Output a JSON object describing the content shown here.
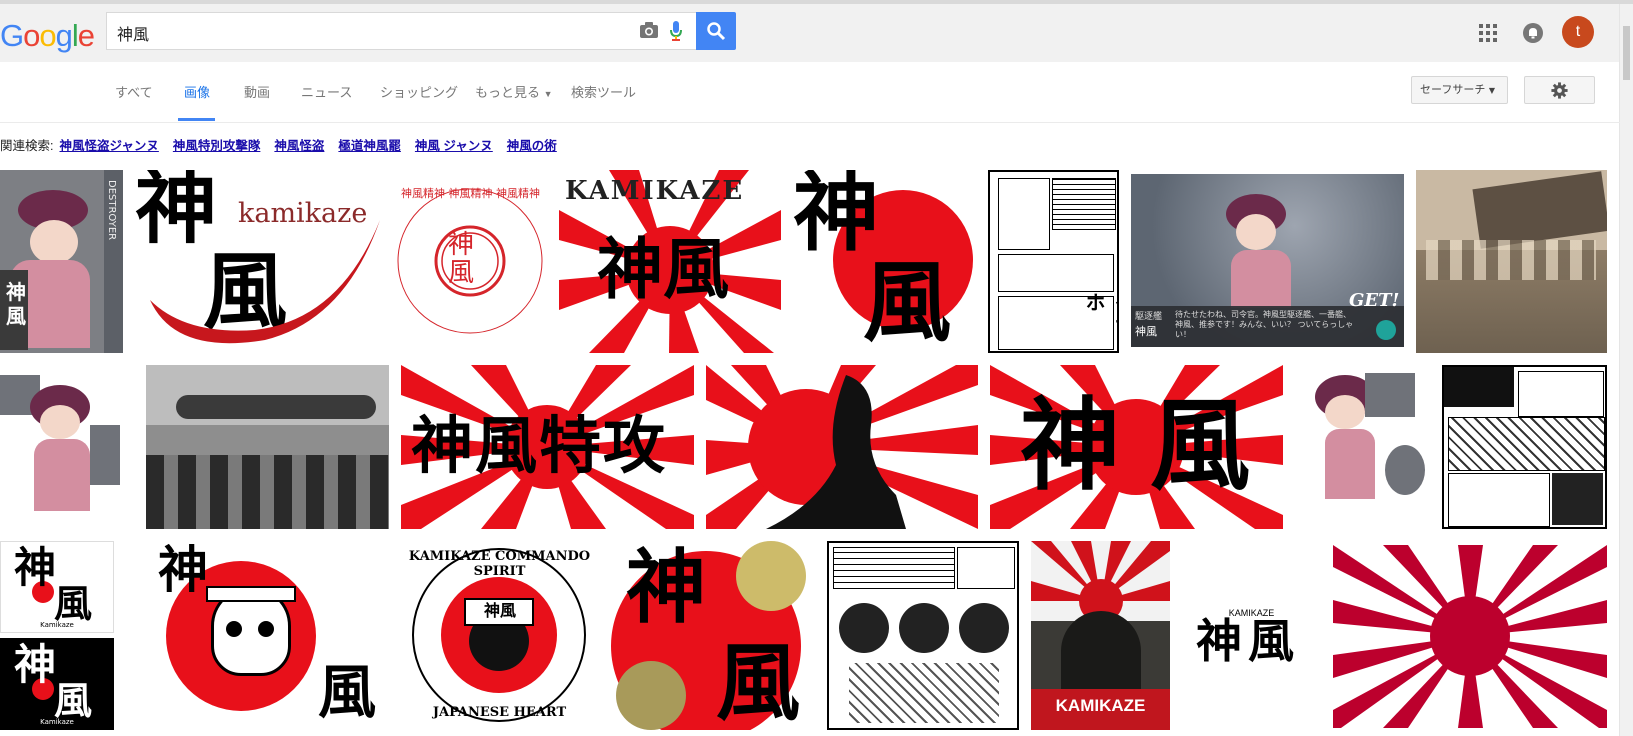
{
  "header": {
    "logo_letters": [
      "G",
      "o",
      "o",
      "g",
      "l",
      "e"
    ],
    "logo_colors": [
      "#4285f4",
      "#ea4335",
      "#fbbc05",
      "#4285f4",
      "#34a853",
      "#ea4335"
    ],
    "search_value": "神風",
    "avatar_letter": "t"
  },
  "nav": {
    "tabs": [
      "すべて",
      "画像",
      "動画",
      "ニュース",
      "ショッピング",
      "もっと見る",
      "検索ツール"
    ],
    "safesearch": "セーフサーチ"
  },
  "related": {
    "label": "関連検索:",
    "links": [
      "神風怪盗ジャンヌ",
      "神風特別攻撃隊",
      "神風怪盗",
      "極道神風罷",
      "神風 ジャンヌ",
      "神風の術"
    ]
  },
  "images": {
    "kamikaze_logo_text": "kamikaze",
    "kamikaze_caps": "KAMIKAZE",
    "kanji_kamikaze": "神風",
    "kanji_tokko": "神風特攻",
    "get_badge": "GET!",
    "game_caption_1": "駆逐艦",
    "game_caption_2": "神風",
    "game_dialog": "待たせたわね、司令官。神風型駆逐艦、一番艦、神風、推参です！みんな、いい？ ついてらっしゃい！",
    "destroyer_text": "DESTROYER",
    "commando_top": "KAMIKAZE COMMANDO SPIRIT",
    "commando_bottom": "JAPANESE HEART",
    "poster_title": "KAMIKAZE",
    "small_caption": "Kamikaze",
    "seal_ring": "神風精神 神風精神 神風精神",
    "seal_center": "神風"
  },
  "colors": {
    "red": "#e8101a",
    "flag_red": "#bc002d",
    "blue": "#4285f4"
  }
}
